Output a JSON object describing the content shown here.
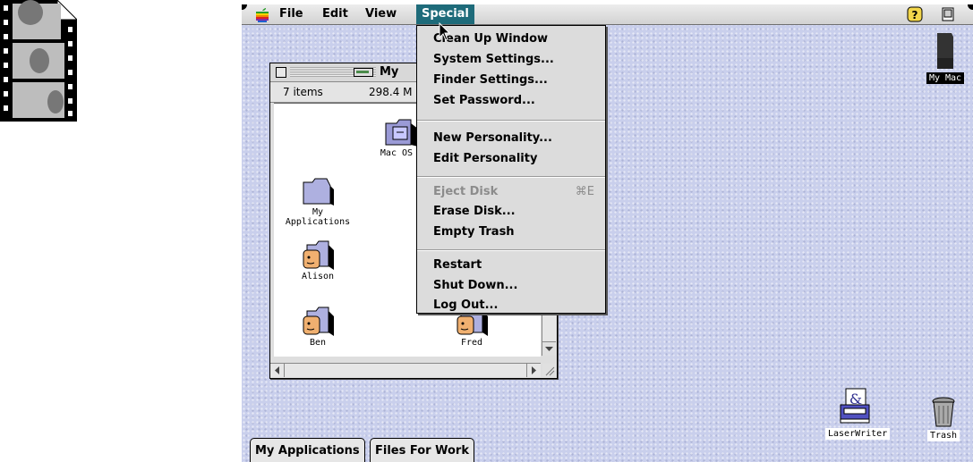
{
  "menubar": {
    "items": [
      {
        "label": "File"
      },
      {
        "label": "Edit"
      },
      {
        "label": "View"
      },
      {
        "label": "Special",
        "active": true
      }
    ]
  },
  "special_menu": {
    "items": [
      {
        "label": "Clean Up Window"
      },
      {
        "label": "System Settings..."
      },
      {
        "label": "Finder Settings..."
      },
      {
        "label": "Set Password..."
      },
      {
        "label": "New Personality..."
      },
      {
        "label": "Edit Personality"
      },
      {
        "label": "Eject Disk",
        "shortcut": "⌘E",
        "disabled": true
      },
      {
        "label": "Erase Disk..."
      },
      {
        "label": "Empty Trash"
      },
      {
        "label": "Restart"
      },
      {
        "label": "Shut Down..."
      },
      {
        "label": "Log Out..."
      }
    ]
  },
  "window": {
    "title": "My",
    "item_count": "7 items",
    "disk_space": "298.4 M",
    "icons": [
      {
        "label": "Mac OS F",
        "type": "system-folder"
      },
      {
        "label": "My Applications",
        "type": "folder"
      },
      {
        "label": "Alison",
        "type": "user-folder"
      },
      {
        "label": "Ben",
        "type": "user-folder"
      },
      {
        "label": "Fred",
        "type": "user-folder"
      }
    ]
  },
  "desktop": {
    "icons": [
      {
        "label": "My Mac",
        "type": "hard-disk"
      },
      {
        "label": "LaserWriter",
        "type": "printer"
      },
      {
        "label": "Trash",
        "type": "trash"
      }
    ]
  },
  "tabs": [
    {
      "label": "My Applications"
    },
    {
      "label": "Files For Work"
    }
  ],
  "colors": {
    "menu_highlight": "#1e6b7a",
    "desktop": "#c9cfec"
  }
}
